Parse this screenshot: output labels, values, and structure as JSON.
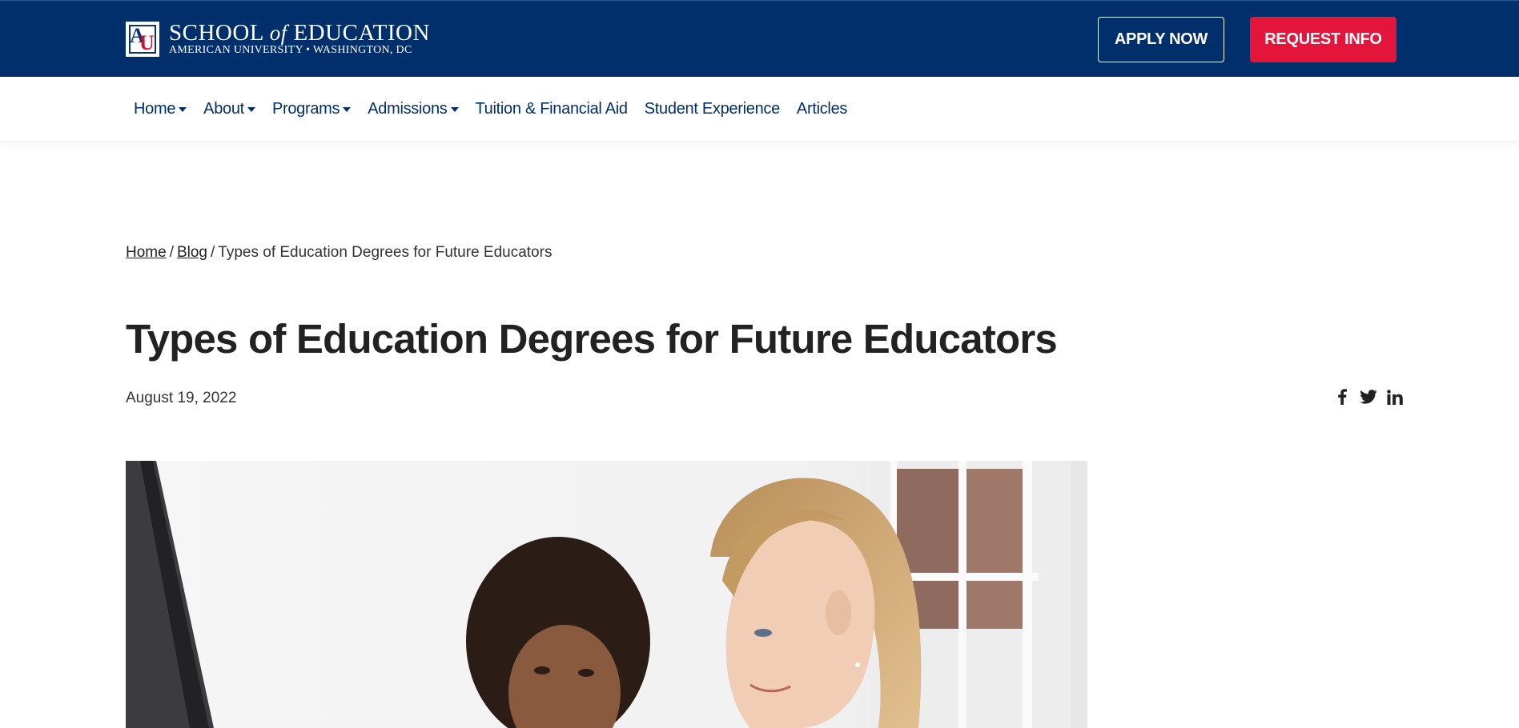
{
  "header": {
    "logo_line1_a": "SCHOOL",
    "logo_line1_of": "of",
    "logo_line1_b": "EDUCATION",
    "logo_line2": "AMERICAN UNIVERSITY • WASHINGTON, DC",
    "apply_label": "APPLY NOW",
    "request_label": "REQUEST INFO"
  },
  "nav": {
    "items": [
      {
        "label": "Home",
        "dropdown": true
      },
      {
        "label": "About",
        "dropdown": true
      },
      {
        "label": "Programs",
        "dropdown": true
      },
      {
        "label": "Admissions",
        "dropdown": true
      },
      {
        "label": "Tuition & Financial Aid",
        "dropdown": false
      },
      {
        "label": "Student Experience",
        "dropdown": false
      },
      {
        "label": "Articles",
        "dropdown": false
      }
    ]
  },
  "breadcrumb": {
    "home": "Home",
    "blog": "Blog",
    "current": "Types of Education Degrees for Future Educators",
    "separator": "/"
  },
  "article": {
    "title": "Types of Education Degrees for Future Educators",
    "date": "August 19, 2022"
  },
  "share": {
    "icons": [
      "facebook-icon",
      "twitter-icon",
      "linkedin-icon"
    ]
  },
  "colors": {
    "brand_navy": "#012f6b",
    "brand_red": "#e4153b"
  }
}
